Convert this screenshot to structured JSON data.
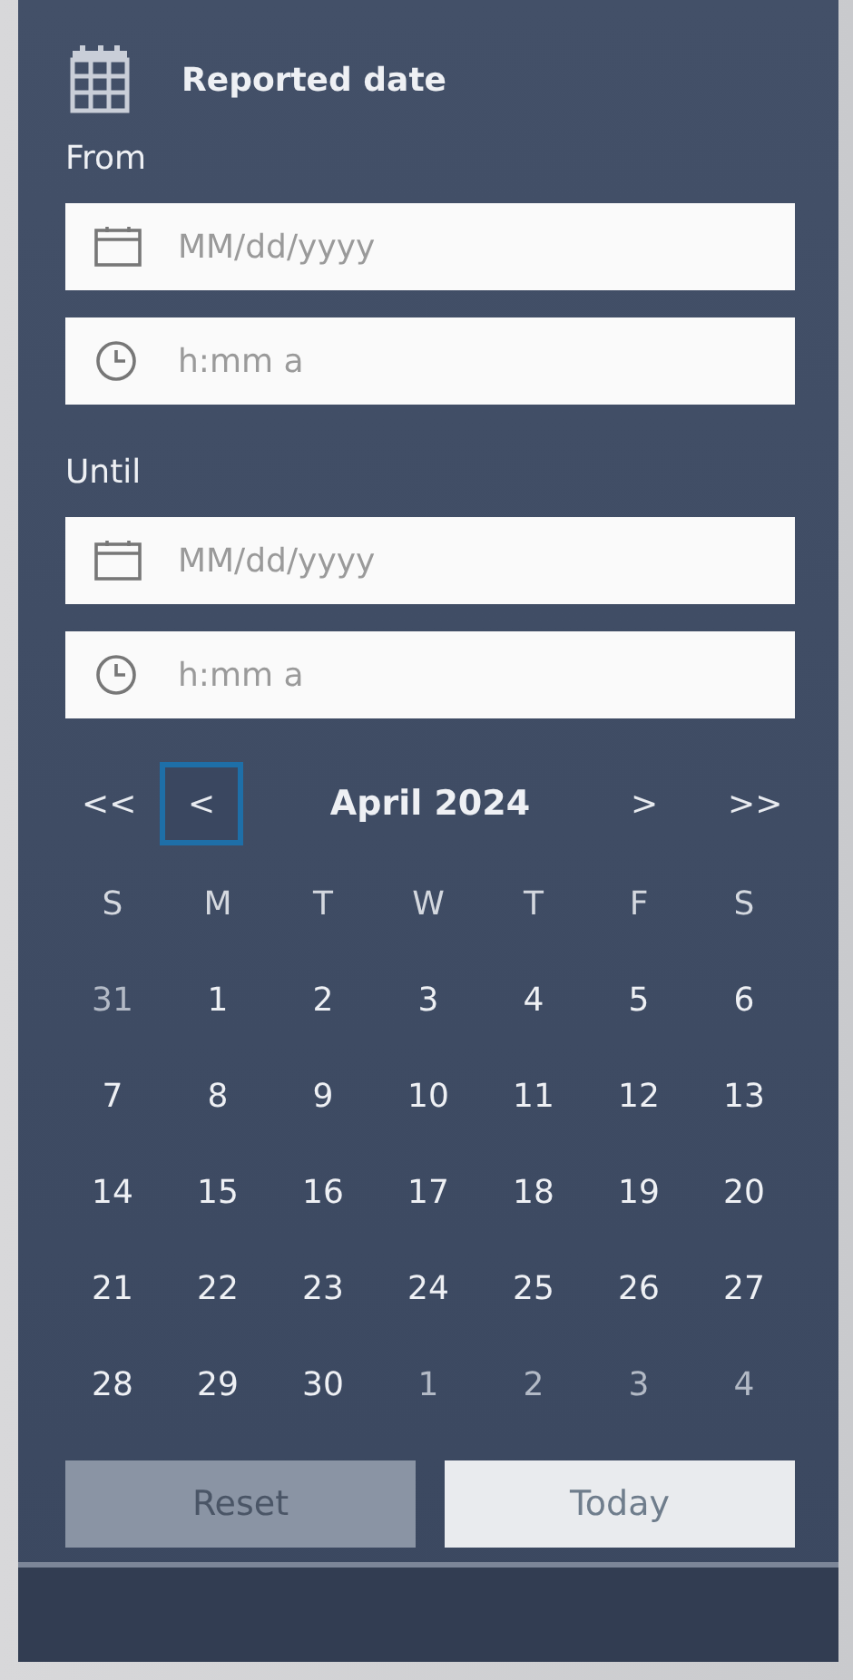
{
  "section": {
    "title": "Reported date"
  },
  "from": {
    "label": "From",
    "date": {
      "placeholder": "MM/dd/yyyy"
    },
    "time": {
      "placeholder": "h:mm a"
    }
  },
  "until": {
    "label": "Until",
    "date": {
      "placeholder": "MM/dd/yyyy"
    },
    "time": {
      "placeholder": "h:mm a"
    }
  },
  "calendar": {
    "title": "April 2024",
    "nav": [
      {
        "label": "<<",
        "kind": "prev-year",
        "focused": false
      },
      {
        "label": "<",
        "kind": "prev-month",
        "focused": true
      },
      {
        "label": ">",
        "kind": "next-month",
        "focused": false
      },
      {
        "label": ">>",
        "kind": "next-year",
        "focused": false
      }
    ],
    "weekdays": [
      "S",
      "M",
      "T",
      "W",
      "T",
      "F",
      "S"
    ],
    "weeks": [
      [
        {
          "label": "31",
          "outside": true
        },
        {
          "label": "1",
          "outside": false
        },
        {
          "label": "2",
          "outside": false
        },
        {
          "label": "3",
          "outside": false
        },
        {
          "label": "4",
          "outside": false
        },
        {
          "label": "5",
          "outside": false
        },
        {
          "label": "6",
          "outside": false
        }
      ],
      [
        {
          "label": "7",
          "outside": false
        },
        {
          "label": "8",
          "outside": false
        },
        {
          "label": "9",
          "outside": false
        },
        {
          "label": "10",
          "outside": false
        },
        {
          "label": "11",
          "outside": false
        },
        {
          "label": "12",
          "outside": false
        },
        {
          "label": "13",
          "outside": false
        }
      ],
      [
        {
          "label": "14",
          "outside": false
        },
        {
          "label": "15",
          "outside": false
        },
        {
          "label": "16",
          "outside": false
        },
        {
          "label": "17",
          "outside": false
        },
        {
          "label": "18",
          "outside": false
        },
        {
          "label": "19",
          "outside": false
        },
        {
          "label": "20",
          "outside": false
        }
      ],
      [
        {
          "label": "21",
          "outside": false
        },
        {
          "label": "22",
          "outside": false
        },
        {
          "label": "23",
          "outside": false
        },
        {
          "label": "24",
          "outside": false
        },
        {
          "label": "25",
          "outside": false
        },
        {
          "label": "26",
          "outside": false
        },
        {
          "label": "27",
          "outside": false
        }
      ],
      [
        {
          "label": "28",
          "outside": false
        },
        {
          "label": "29",
          "outside": false
        },
        {
          "label": "30",
          "outside": false
        },
        {
          "label": "1",
          "outside": true
        },
        {
          "label": "2",
          "outside": true
        },
        {
          "label": "3",
          "outside": true
        },
        {
          "label": "4",
          "outside": true
        }
      ]
    ]
  },
  "buttons": [
    {
      "label": "Reset",
      "disabled": true
    },
    {
      "label": "Today",
      "disabled": false
    }
  ]
}
